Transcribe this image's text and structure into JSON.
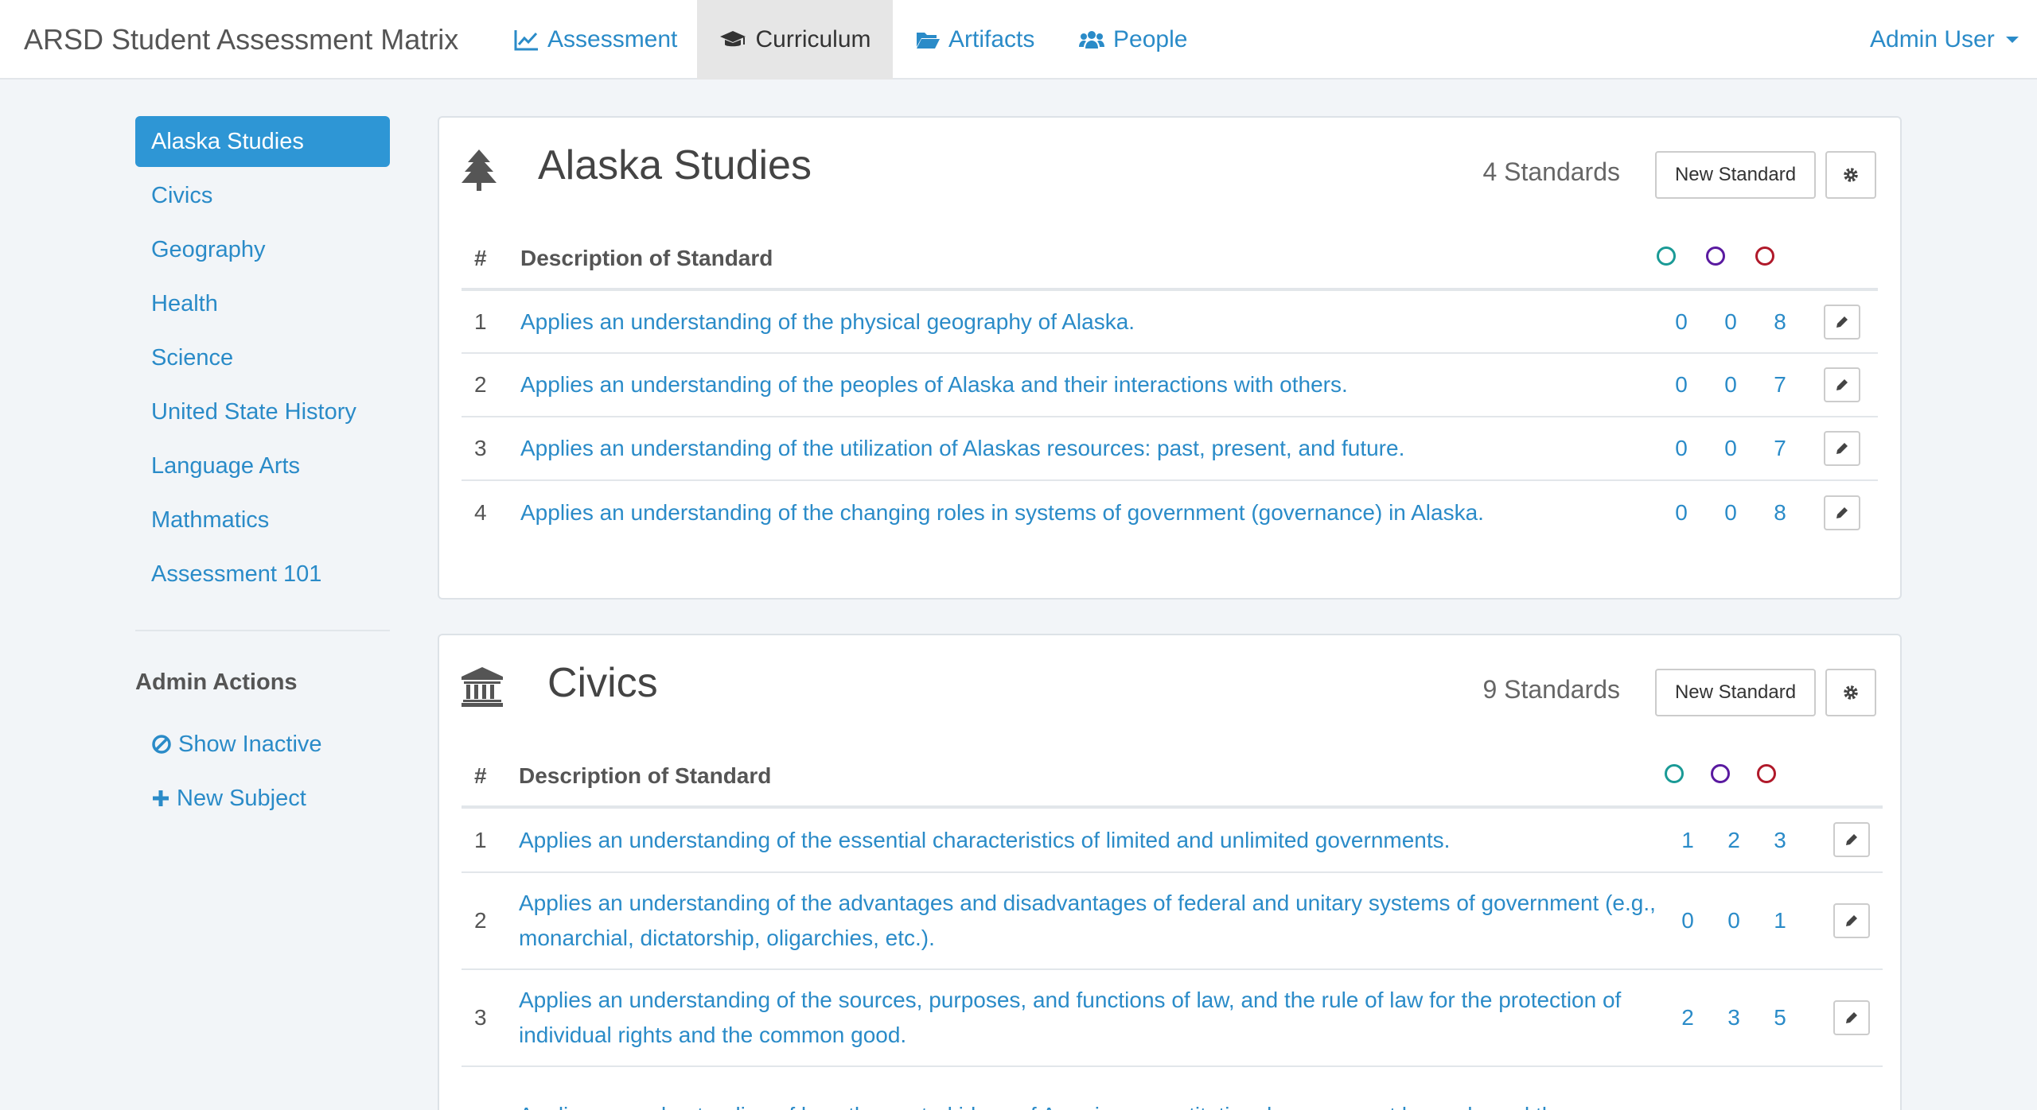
{
  "app": {
    "title": "ARSD Student Assessment Matrix"
  },
  "nav": {
    "assessment": "Assessment",
    "curriculum": "Curriculum",
    "artifacts": "Artifacts",
    "people": "People",
    "user": "Admin User"
  },
  "colors": {
    "accent": "#2a8bc8",
    "active_bg": "#2e96d5",
    "teal": "#1a9a96",
    "purple": "#5a1aa0",
    "red": "#b0192a"
  },
  "sidebar": {
    "subjects": [
      "Alaska Studies",
      "Civics",
      "Geography",
      "Health",
      "Science",
      "United State History",
      "Language Arts",
      "Mathmatics",
      "Assessment 101"
    ],
    "active": "Alaska Studies",
    "admin_heading": "Admin Actions",
    "show_inactive": "Show Inactive",
    "new_subject": "New Subject"
  },
  "panels": [
    {
      "title": "Alaska Studies",
      "icon": "tree-icon",
      "count_label": "4 Standards",
      "new_label": "New Standard",
      "col_num": "#",
      "col_desc": "Description of Standard",
      "rows": [
        {
          "num": "1",
          "desc": "Applies an understanding of the physical geography of Alaska.",
          "scores": [
            "0",
            "0",
            "8"
          ]
        },
        {
          "num": "2",
          "desc": "Applies an understanding of the peoples of Alaska and their interactions with others.",
          "scores": [
            "0",
            "0",
            "7"
          ]
        },
        {
          "num": "3",
          "desc": "Applies an understanding of the utilization of Alaskas resources: past, present, and future.",
          "scores": [
            "0",
            "0",
            "7"
          ]
        },
        {
          "num": "4",
          "desc": "Applies an understanding of the changing roles in systems of government (governance) in Alaska.",
          "scores": [
            "0",
            "0",
            "8"
          ]
        }
      ]
    },
    {
      "title": "Civics",
      "icon": "institution-icon",
      "count_label": "9 Standards",
      "new_label": "New Standard",
      "col_num": "#",
      "col_desc": "Description of Standard",
      "rows": [
        {
          "num": "1",
          "desc": "Applies an understanding of the essential characteristics of limited and unlimited governments.",
          "scores": [
            "1",
            "2",
            "3"
          ]
        },
        {
          "num": "2",
          "desc": "Applies an understanding of the advantages and disadvantages of federal and unitary systems of government (e.g., monarchial, dictatorship, oligarchies, etc.).",
          "scores": [
            "0",
            "0",
            "1"
          ]
        },
        {
          "num": "3",
          "desc": "Applies an understanding of the sources, purposes, and functions of law, and the rule of law for the protection of individual rights and the common good.",
          "scores": [
            "2",
            "3",
            "5"
          ]
        },
        {
          "num": "",
          "desc": "Applies an understanding of how the central ideas of American constitutional government have shaped the",
          "scores": [
            "",
            "",
            ""
          ]
        }
      ]
    }
  ]
}
